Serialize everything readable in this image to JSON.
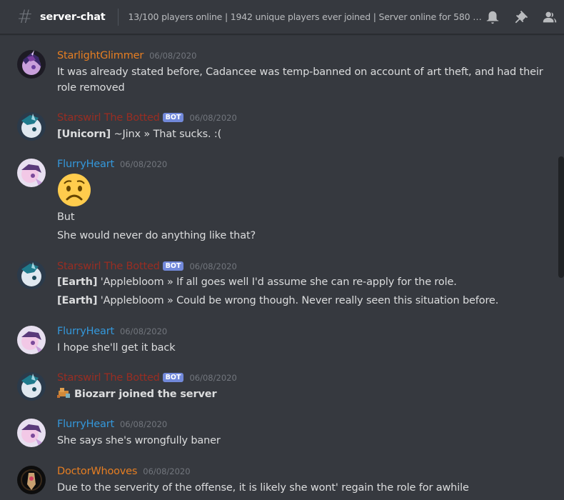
{
  "channel": {
    "name": "server-chat",
    "topic": "13/100 players online | 1942 unique players ever joined | Server online for 580 minu..."
  },
  "header_icons": [
    "bell-icon",
    "pin-icon",
    "members-icon"
  ],
  "colors": {
    "background": "#36393f",
    "bot_badge": "#7289da",
    "starlight": "#e67e22",
    "starswirl": "#992d22",
    "flurry": "#3498db",
    "doctor": "#e67e22"
  },
  "messages": [
    {
      "author": "StarlightGlimmer",
      "timestamp": "06/08/2020",
      "lines": [
        "It was already stated before, Cadancee was temp-banned on account of art theft, and had their",
        "role removed"
      ]
    },
    {
      "author": "Starswirl The Botted",
      "bot": "BOT",
      "timestamp": "06/08/2020",
      "lines": [
        {
          "tag": "[Unicorn]",
          "text": " ~Jinx » That sucks. :("
        }
      ]
    },
    {
      "author": "FlurryHeart",
      "timestamp": "06/08/2020",
      "emoji": "worried-face",
      "lines": [
        "But",
        "She would never do anything like that?"
      ]
    },
    {
      "author": "Starswirl The Botted",
      "bot": "BOT",
      "timestamp": "06/08/2020",
      "lines": [
        {
          "tag": "[Earth]",
          "text": " 'Applebloom » If all goes well I'd assume she can re-apply for the role."
        },
        {
          "tag": "[Earth]",
          "text": " 'Applebloom » Could be wrong though. Never really seen this situation before."
        }
      ]
    },
    {
      "author": "FlurryHeart",
      "timestamp": "06/08/2020",
      "lines": [
        "I hope she'll get it back"
      ]
    },
    {
      "author": "Starswirl The Botted",
      "bot": "BOT",
      "timestamp": "06/08/2020",
      "lines": [
        "Biozarr joined the server"
      ]
    },
    {
      "author": "FlurryHeart",
      "timestamp": "06/08/2020",
      "lines": [
        "She says she's wrongfully baner"
      ]
    },
    {
      "author": "DoctorWhooves",
      "timestamp": "06/08/2020",
      "lines": [
        "Due to the serverity of the offense, it is likely she wont' regain the role for awhile"
      ]
    }
  ]
}
